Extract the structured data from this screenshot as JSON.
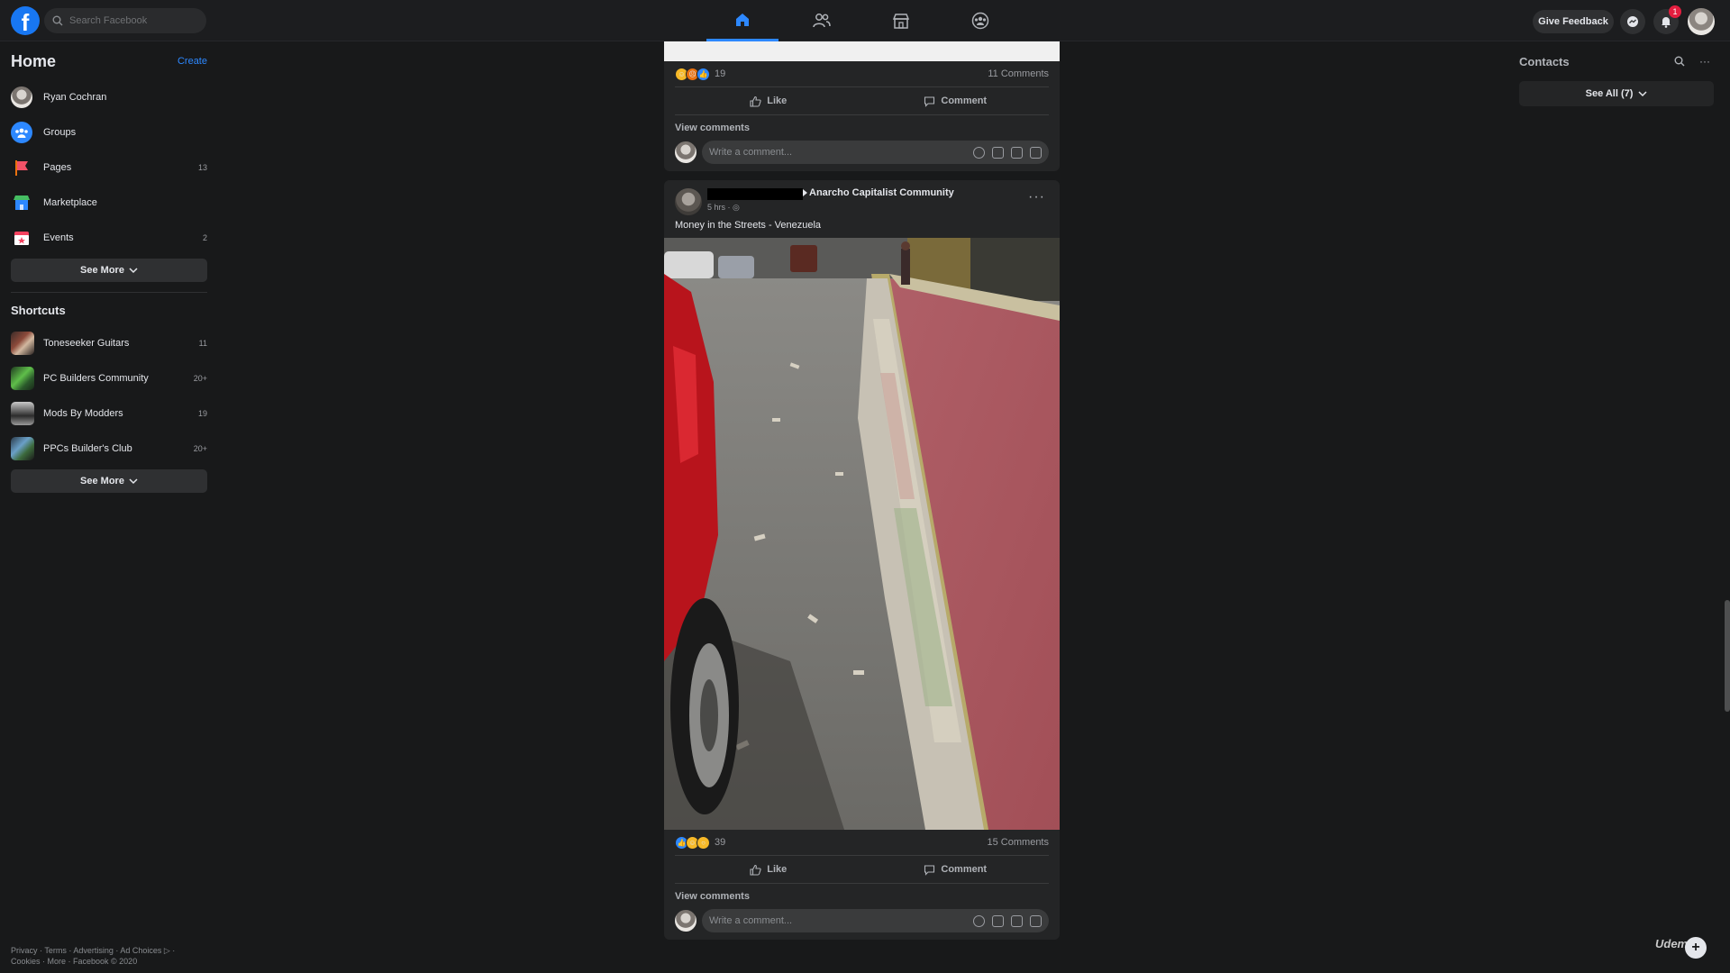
{
  "topbar": {
    "logo": "f",
    "search_placeholder": "Search Facebook",
    "give_feedback": "Give Feedback",
    "notification_count": "1"
  },
  "left": {
    "title": "Home",
    "create": "Create",
    "items": [
      {
        "label": "Ryan Cochran",
        "count": ""
      },
      {
        "label": "Groups",
        "count": ""
      },
      {
        "label": "Pages",
        "count": "13"
      },
      {
        "label": "Marketplace",
        "count": ""
      },
      {
        "label": "Events",
        "count": "2"
      }
    ],
    "see_more_1": "See More",
    "shortcuts_title": "Shortcuts",
    "shortcuts": [
      {
        "label": "Toneseeker Guitars",
        "count": "11"
      },
      {
        "label": "PC Builders Community",
        "count": "20+"
      },
      {
        "label": "Mods By Modders",
        "count": "19"
      },
      {
        "label": "PPCs Builder's Club",
        "count": "20+"
      }
    ],
    "see_more_2": "See More",
    "footer_line1": "Privacy · Terms · Advertising · Ad Choices ▷ ·",
    "footer_line2": "Cookies · More · Facebook © 2020"
  },
  "post1": {
    "reaction_count": "19",
    "comments": "11 Comments",
    "like": "Like",
    "comment": "Comment",
    "view_comments": "View comments",
    "comment_placeholder": "Write a comment..."
  },
  "post2": {
    "group": "Anarcho Capitalist Community",
    "time": "5 hrs · ◎",
    "text": "Money in the Streets - Venezuela",
    "reaction_count": "39",
    "comments": "15 Comments",
    "like": "Like",
    "comment": "Comment",
    "view_comments": "View comments",
    "comment_placeholder": "Write a comment..."
  },
  "right": {
    "title": "Contacts",
    "see_all": "See All (7)"
  },
  "watermark": "Udemy",
  "colors": {
    "accent": "#2d88ff",
    "background": "#18191a",
    "card": "#242526",
    "badge": "#e41e3f"
  }
}
